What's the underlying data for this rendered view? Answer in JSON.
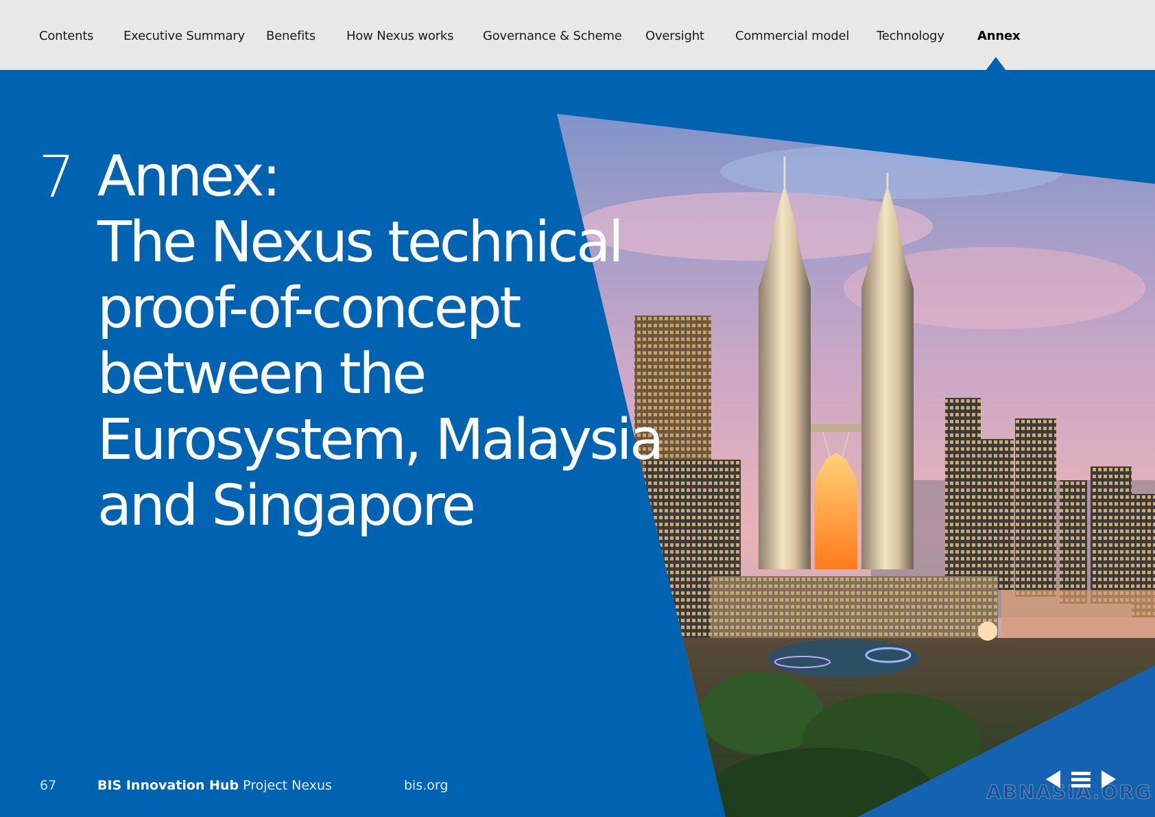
{
  "nav": {
    "items": [
      {
        "label": "Contents",
        "active": false
      },
      {
        "label": "Executive Summary",
        "active": false
      },
      {
        "label": "Benefits",
        "active": false
      },
      {
        "label": "How Nexus works",
        "active": false
      },
      {
        "label": "Governance & Scheme",
        "active": false
      },
      {
        "label": "Oversight",
        "active": false
      },
      {
        "label": "Commercial model",
        "active": false
      },
      {
        "label": "Technology",
        "active": false
      },
      {
        "label": "Annex",
        "active": true
      }
    ]
  },
  "section": {
    "number": "7",
    "title_lines": [
      "Annex:",
      "The Nexus technical",
      "proof-of-concept",
      "between the",
      "Eurosystem, Malaysia",
      "and Singapore"
    ]
  },
  "footer": {
    "page_number": "67",
    "brand_bold": "BIS Innovation Hub",
    "brand_light": "Project Nexus",
    "site": "bis.org"
  },
  "controls": {
    "icons": [
      "previous-page-icon",
      "menu-icon",
      "next-page-icon"
    ]
  },
  "watermark": "ABNASIA.ORG",
  "colors": {
    "background": "#0063b2",
    "nav_bar": "#e8e8e8",
    "text": "#ffffff"
  }
}
